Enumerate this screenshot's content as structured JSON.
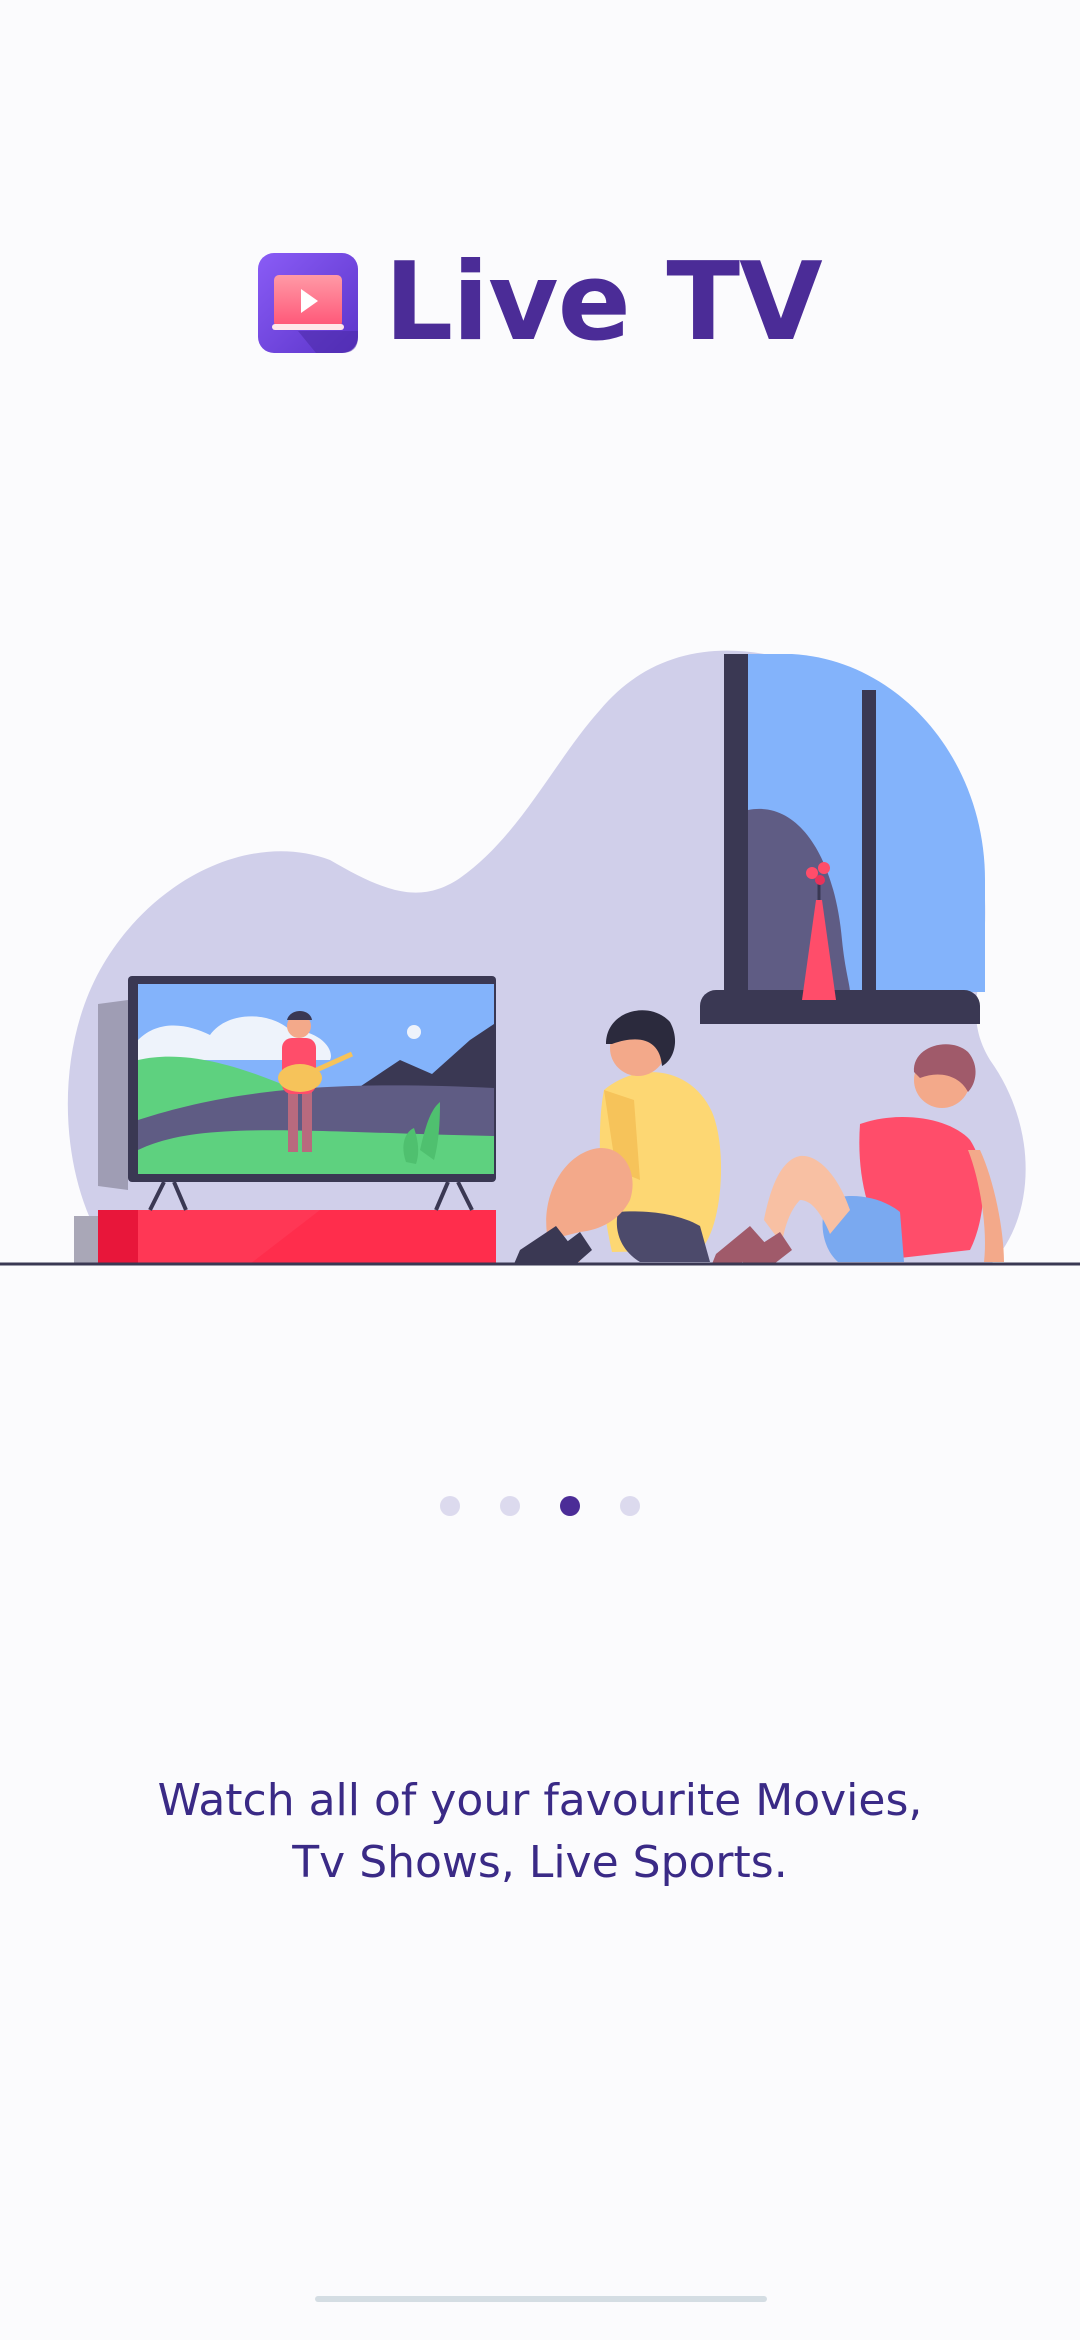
{
  "brand": {
    "app_name": "Live TV",
    "icon": "play-screen-icon"
  },
  "illustration": {
    "subject": "tv-watching-illustration"
  },
  "pager": {
    "page_count": 4,
    "active_page": 3
  },
  "onboarding": {
    "tagline_line1": "Watch all of your favourite Movies,",
    "tagline_line2": "Tv Shows, Live Sports."
  },
  "colors": {
    "brand_purple": "#4b2c97",
    "icon_gradient_start": "#8a5cf6",
    "icon_gradient_end": "#5b34c9",
    "accent_pink": "#ff4d6a",
    "blob_lavender": "#d0cfea",
    "sky_blue": "#83b3fb",
    "dot_inactive": "#dcdaee"
  }
}
